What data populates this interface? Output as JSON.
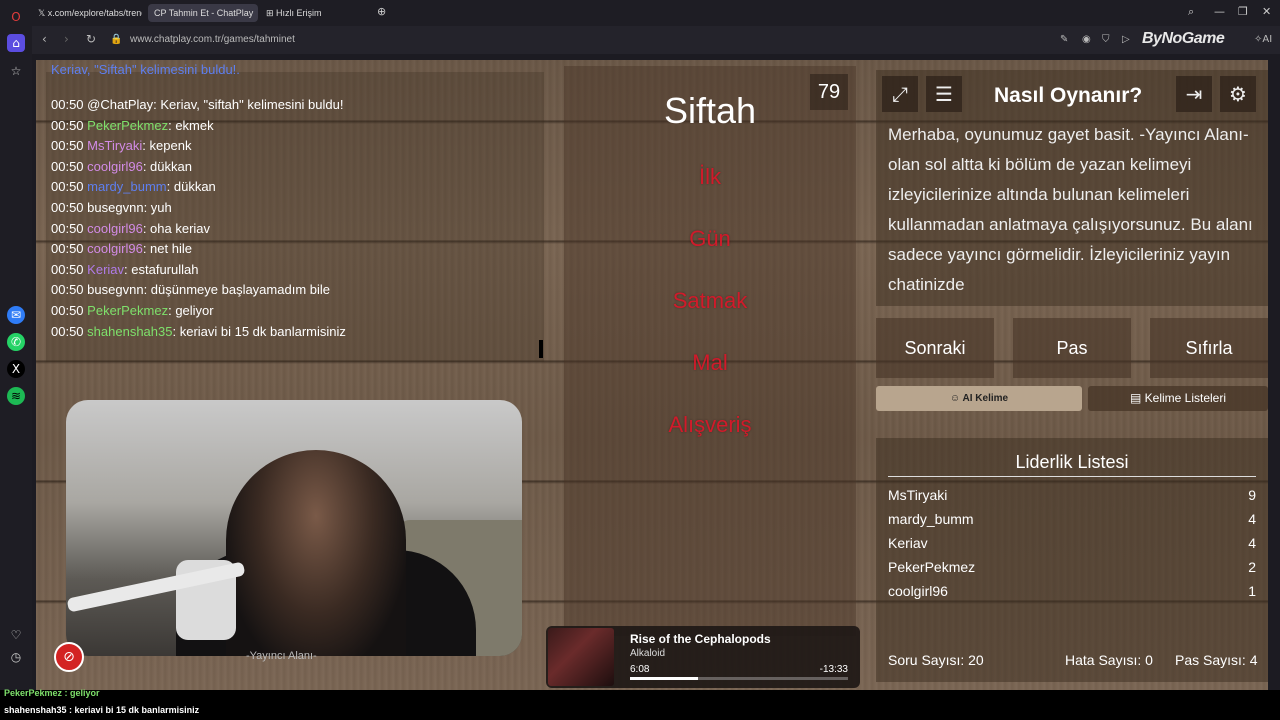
{
  "browser": {
    "tabs": [
      {
        "label": "x.com/explore/tabs/trend"
      },
      {
        "label": "Tahmin Et - ChatPlay"
      },
      {
        "label": "Hızlı Erişim"
      }
    ],
    "url": "www.chatplay.com.tr/games/tahminet",
    "brand": "ByNoGame",
    "ai_label": "AI"
  },
  "chat": {
    "first_line": "Keriav, \"Siftah\" kelimesini buldu!.",
    "messages": [
      {
        "time": "00:50",
        "user": "@ChatPlay",
        "user_color": "#ffffff",
        "text": ": Keriav, \"siftah\" kelimesini buldu!"
      },
      {
        "time": "00:50",
        "user": "PekerPekmez",
        "user_color": "#7ee06b",
        "text": ": ekmek"
      },
      {
        "time": "00:50",
        "user": "MsTiryaki",
        "user_color": "#d28be6",
        "text": ": kepenk"
      },
      {
        "time": "00:50",
        "user": "coolgirl96",
        "user_color": "#d28be6",
        "text": ": dükkan"
      },
      {
        "time": "00:50",
        "user": "mardy_bumm",
        "user_color": "#5e7ff0",
        "text": ": dükkan"
      },
      {
        "time": "00:50",
        "user": "busegvnn",
        "user_color": "#ffffff",
        "text": ": yuh"
      },
      {
        "time": "00:50",
        "user": "coolgirl96",
        "user_color": "#d28be6",
        "text": ": oha keriav"
      },
      {
        "time": "00:50",
        "user": "coolgirl96",
        "user_color": "#d28be6",
        "text": ": net hile"
      },
      {
        "time": "00:50",
        "user": "Keriav",
        "user_color": "#b07be8",
        "text": ": estafurullah"
      },
      {
        "time": "00:50",
        "user": "busegvnn",
        "user_color": "#ffffff",
        "text": ": düşünmeye başlayamadım bile"
      },
      {
        "time": "00:50",
        "user": "PekerPekmez",
        "user_color": "#7ee06b",
        "text": ": geliyor"
      },
      {
        "time": "00:50",
        "user": "shahenshah35",
        "user_color": "#7ee06b",
        "text": ": keriavi bi 15 dk banlarmisiniz"
      }
    ]
  },
  "camera": {
    "caption": "-Yayıncı Alanı-"
  },
  "card": {
    "timer": "79",
    "word": "Siftah",
    "taboo": [
      "İlk",
      "Gün",
      "Satmak",
      "Mal",
      "Alışveriş"
    ]
  },
  "howto": {
    "title": "Nasıl Oynanır?",
    "text": "Merhaba, oyunumuz gayet basit. -Yayıncı Alanı- olan sol altta ki bölüm de yazan kelimeyi izleyicilerinize altında bulunan kelimeleri kullanmadan anlatmaya çalışıyorsunuz. Bu alanı sadece yayıncı görmelidir. İzleyicileriniz yayın chatinizde"
  },
  "actions": {
    "next": "Sonraki",
    "pass": "Pas",
    "reset": "Sıfırla",
    "ai_word": "AI Kelime",
    "word_lists": "Kelime Listeleri"
  },
  "leaderboard": {
    "title": "Liderlik Listesi",
    "rows": [
      {
        "name": "MsTiryaki",
        "score": "9"
      },
      {
        "name": "mardy_bumm",
        "score": "4"
      },
      {
        "name": "Keriav",
        "score": "4"
      },
      {
        "name": "PekerPekmez",
        "score": "2"
      },
      {
        "name": "coolgirl96",
        "score": "1"
      }
    ]
  },
  "stats": {
    "questions": "Soru Sayısı: 20",
    "errors": "Hata Sayısı: 0",
    "passes": "Pas Sayısı: 4"
  },
  "music": {
    "title": "Rise of the Cephalopods",
    "artist": "Alkaloid",
    "current": "6:08",
    "remaining": "-13:33",
    "progress": 0.31
  },
  "overlay_chat": [
    {
      "text": "PekerPekmez : geliyor"
    },
    {
      "text": "shahenshah35 : keriavi bi 15 dk banlarmisiniz"
    }
  ]
}
